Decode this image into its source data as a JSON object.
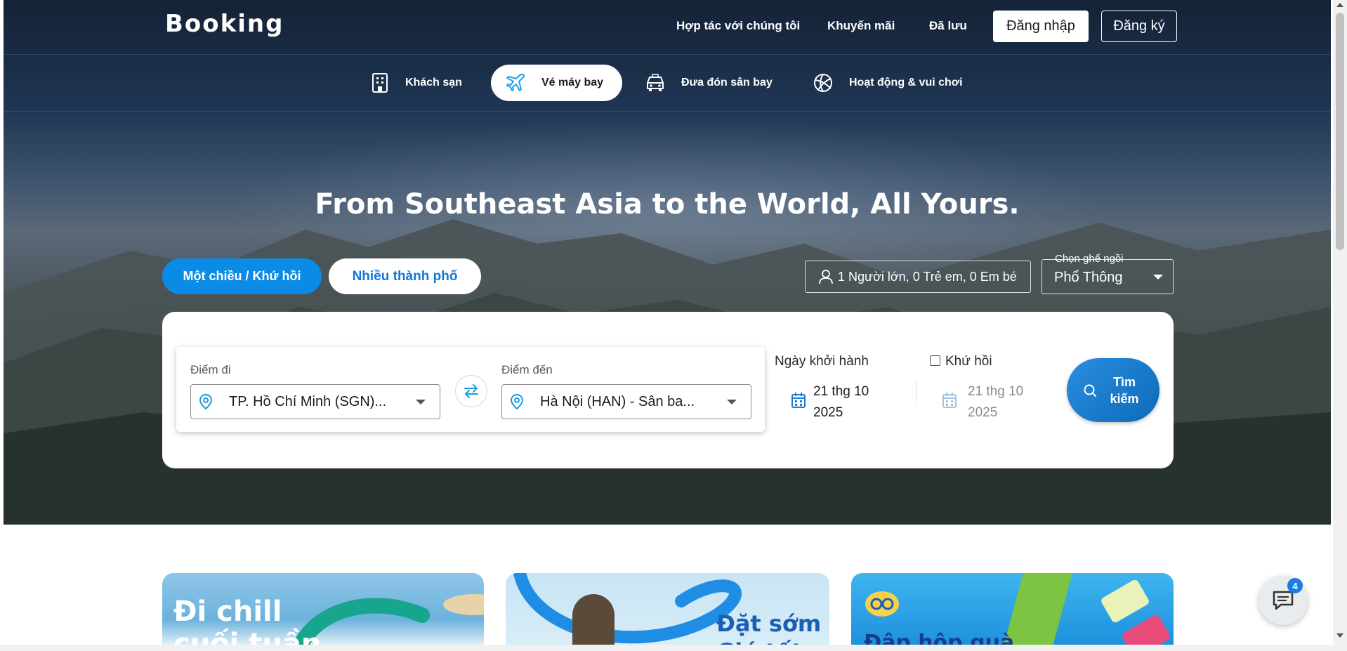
{
  "header": {
    "logo": "Booking",
    "nav": [
      "Hợp tác với chúng tôi",
      "Khuyến mãi",
      "Đã lưu"
    ],
    "login_label": "Đăng nhập",
    "register_label": "Đăng ký"
  },
  "services": [
    {
      "label": "Khách sạn",
      "icon": "hotel-icon"
    },
    {
      "label": "Vé máy bay",
      "icon": "plane-icon",
      "active": true
    },
    {
      "label": "Đưa đón sân bay",
      "icon": "car-icon"
    },
    {
      "label": "Hoạt động & vui chơi",
      "icon": "ball-icon"
    }
  ],
  "hero": {
    "headline": "From Southeast Asia to the World, All Yours."
  },
  "trip_type": {
    "one_way_round": "Một chiều / Khứ hồi",
    "multi_city": "Nhiều thành phố"
  },
  "passengers": "1 Người lớn, 0 Trẻ em, 0 Em bé",
  "seat_class": {
    "label": "Chọn ghế ngồi",
    "value": "Phổ Thông"
  },
  "search_form": {
    "origin_label": "Điểm đi",
    "origin_value": "TP. Hồ Chí Minh (SGN)...",
    "destination_label": "Điểm đến",
    "destination_value": "Hà Nội (HAN) - Sân ba...",
    "depart_label": "Ngày khởi hành",
    "depart_line1": "21 thg 10",
    "depart_line2": "2025",
    "return_label": "Khứ hồi",
    "return_line1": "21 thg 10",
    "return_line2": "2025",
    "search_line1": "Tìm",
    "search_line2": "kiếm"
  },
  "promos": [
    {
      "line1": "Đi chill",
      "line2": "cuối tuần"
    },
    {
      "line1": "Đặt sớm",
      "line2": "Giá tốt"
    },
    {
      "line1": "Đập hộp quà"
    }
  ],
  "chat": {
    "badge": "4"
  },
  "colors": {
    "accent": "#0a8ce6",
    "link_blue": "#1577d8",
    "search_button": "#1a7dd0"
  }
}
